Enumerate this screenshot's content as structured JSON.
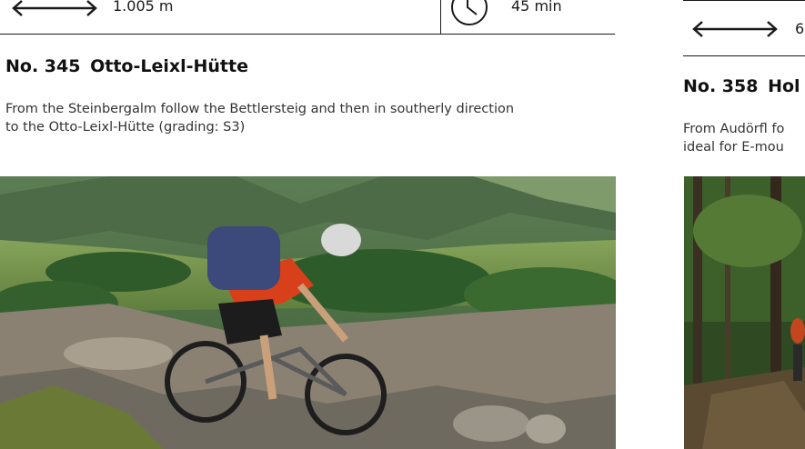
{
  "left": {
    "distance": "1.005 m",
    "time": "45 min",
    "tour_number": "No. 345",
    "tour_name": "Otto-Leixl-Hütte",
    "description_line1": "From the Steinbergalm follow the Bettlersteig and then in southerly direction",
    "description_line2": "to the Otto-Leixl-Hütte (grading: S3)"
  },
  "right": {
    "distance_partial": "6",
    "tour_number": "No. 358",
    "tour_name_partial": "Hol",
    "description_line1": "From Audörfl fo",
    "description_line2": "ideal for E-mou"
  },
  "icons": {
    "distance": "double-arrow-icon",
    "time": "clock-icon"
  },
  "colors": {
    "text": "#1a1a1a",
    "rule": "#1a1a1a"
  }
}
